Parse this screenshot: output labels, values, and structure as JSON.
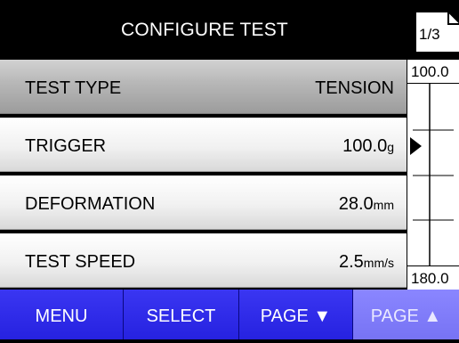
{
  "header": {
    "title": "CONFIGURE TEST",
    "page_indicator": "1/3"
  },
  "rows": [
    {
      "label": "TEST TYPE",
      "value": "TENSION",
      "unit": "",
      "selected": true
    },
    {
      "label": "TRIGGER",
      "value": "100.0",
      "unit": "g",
      "selected": false
    },
    {
      "label": "DEFORMATION",
      "value": "28.0",
      "unit": "mm",
      "selected": false
    },
    {
      "label": "TEST SPEED",
      "value": "2.5",
      "unit": "mm/s",
      "selected": false
    }
  ],
  "scale": {
    "top_value": "100.0",
    "bottom_value": "180.0",
    "pointer_icon": "triangle-right-icon"
  },
  "softkeys": {
    "menu": "MENU",
    "select": "SELECT",
    "page_down": "PAGE ▼",
    "page_up": "PAGE ▲"
  },
  "colors": {
    "softkey_bar": "#2b28e8",
    "softkey_disabled": "#8a86ff",
    "header_bg": "#000000"
  }
}
